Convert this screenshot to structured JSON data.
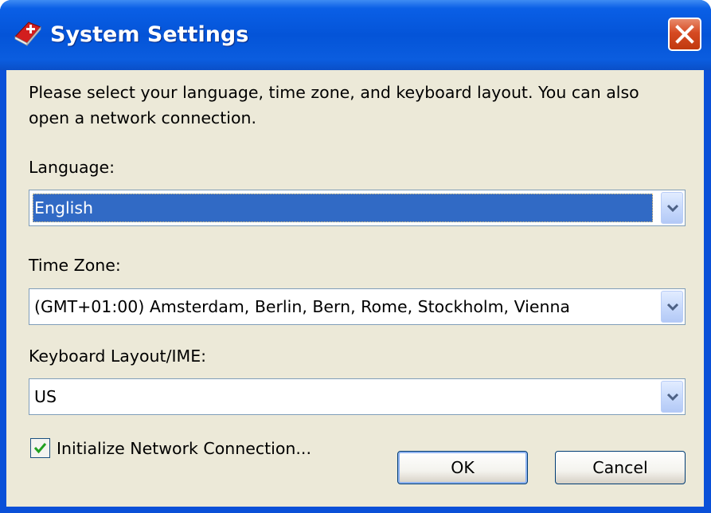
{
  "window": {
    "title": "System Settings",
    "icon": "app-icon",
    "close_icon": "close-icon"
  },
  "intro": {
    "line1": "Please select your language, time zone, and keyboard layout. You can also",
    "line2": "open a network connection."
  },
  "language": {
    "label": "Language:",
    "value": "English"
  },
  "time_zone": {
    "label": "Time Zone:",
    "value": "(GMT+01:00) Amsterdam, Berlin, Bern, Rome, Stockholm, Vienna"
  },
  "keyboard": {
    "label": "Keyboard Layout/IME:",
    "value": "US"
  },
  "network": {
    "label": "Initialize Network Connection...",
    "checked": true
  },
  "buttons": {
    "ok": "OK",
    "cancel": "Cancel"
  },
  "colors": {
    "title_bar": "#0454d8",
    "client_bg": "#ece9d8",
    "selection": "#316ac5",
    "close_button": "#d64a22",
    "check_mark": "#21a121"
  }
}
